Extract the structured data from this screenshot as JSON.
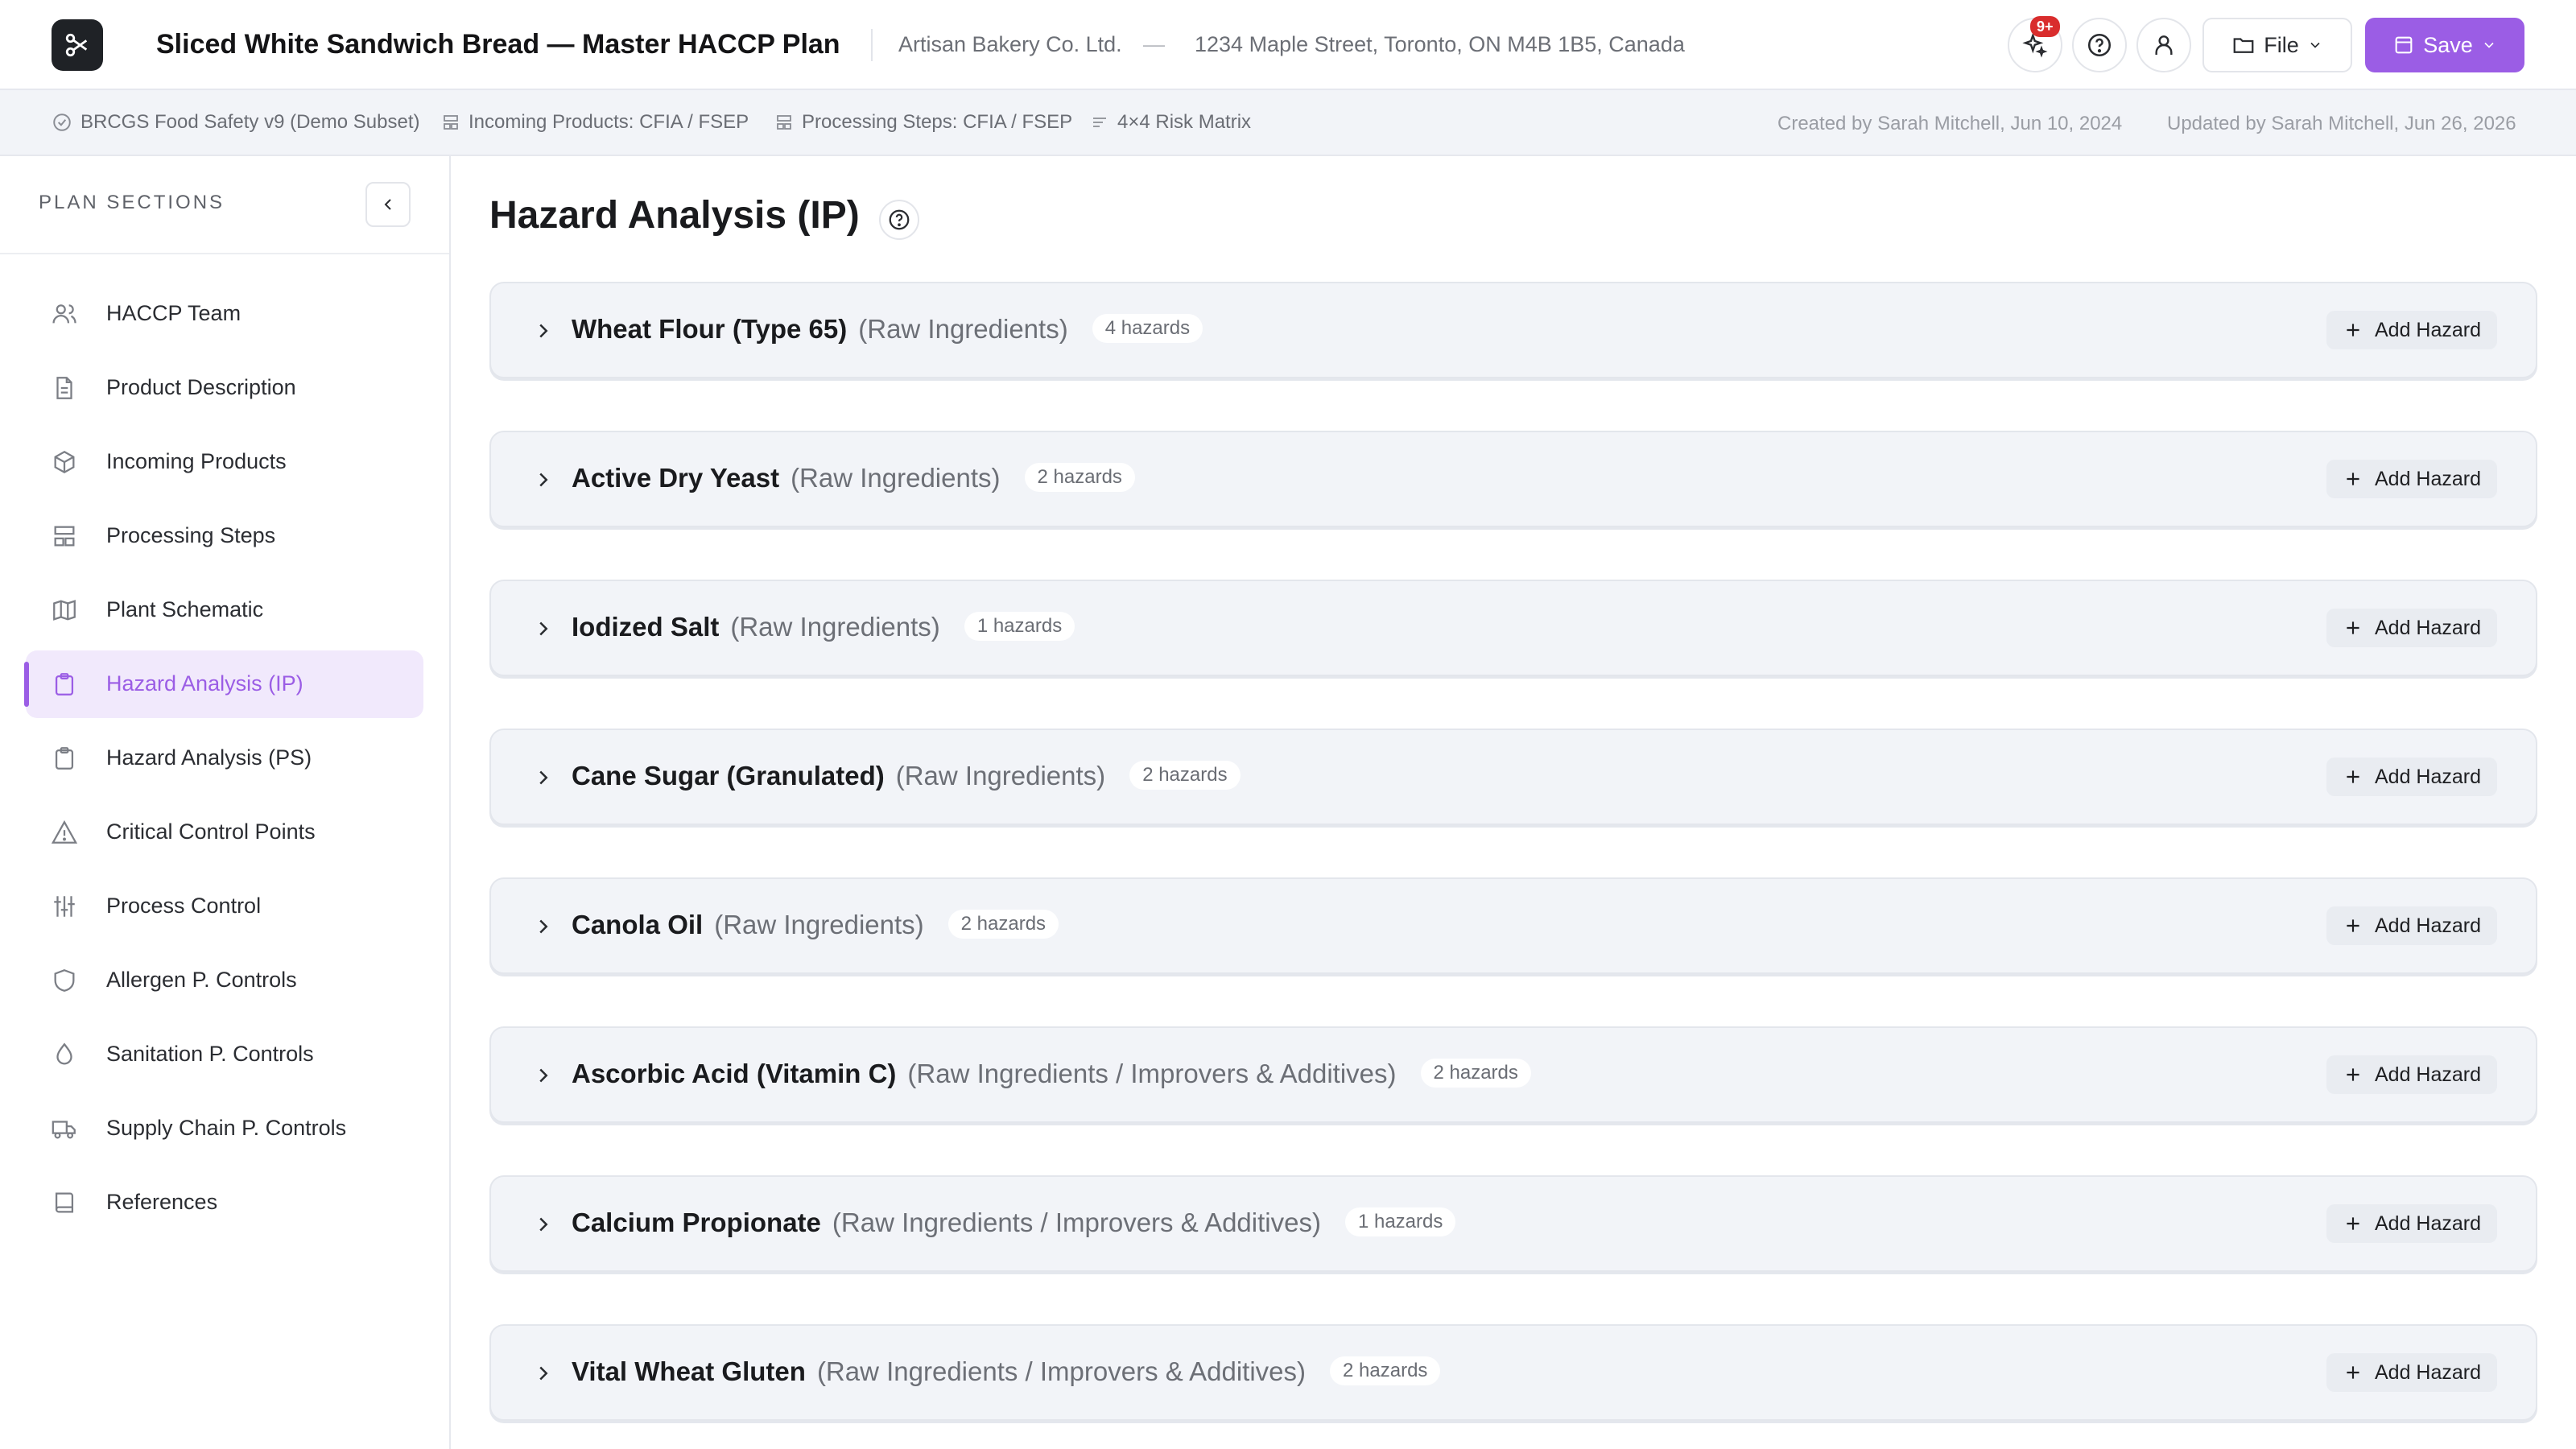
{
  "header": {
    "title": "Sliced White Sandwich Bread — Master HACCP Plan",
    "company": "Artisan Bakery Co. Ltd.",
    "separator": "—",
    "address": "1234 Maple Street, Toronto, ON M4B 1B5, Canada",
    "notification_count": "9+",
    "file_label": "File",
    "save_label": "Save"
  },
  "subbar": {
    "standard": "BRCGS Food Safety v9 (Demo Subset)",
    "incoming": "Incoming Products: CFIA / FSEP",
    "processing": "Processing Steps: CFIA / FSEP",
    "matrix": "4×4 Risk Matrix",
    "created": "Created by Sarah Mitchell, Jun 10, 2024",
    "updated": "Updated by Sarah Mitchell, Jun 26, 2026"
  },
  "sidebar": {
    "heading": "PLAN SECTIONS",
    "items": [
      {
        "label": "HACCP Team",
        "icon": "team-icon"
      },
      {
        "label": "Product Description",
        "icon": "document-icon"
      },
      {
        "label": "Incoming Products",
        "icon": "box-icon"
      },
      {
        "label": "Processing Steps",
        "icon": "layout-icon"
      },
      {
        "label": "Plant Schematic",
        "icon": "map-icon"
      },
      {
        "label": "Hazard Analysis (IP)",
        "icon": "clipboard-icon",
        "active": true
      },
      {
        "label": "Hazard Analysis (PS)",
        "icon": "clipboard-icon"
      },
      {
        "label": "Critical Control Points",
        "icon": "warning-icon"
      },
      {
        "label": "Process Control",
        "icon": "sliders-icon"
      },
      {
        "label": "Allergen P. Controls",
        "icon": "shield-icon"
      },
      {
        "label": "Sanitation P. Controls",
        "icon": "droplet-icon"
      },
      {
        "label": "Supply Chain P. Controls",
        "icon": "truck-icon"
      },
      {
        "label": "References",
        "icon": "book-icon"
      }
    ]
  },
  "main": {
    "title": "Hazard Analysis (IP)",
    "add_label": "Add Hazard",
    "products": [
      {
        "name": "Wheat Flour (Type 65)",
        "category": "(Raw Ingredients)",
        "count": "4 hazards"
      },
      {
        "name": "Active Dry Yeast",
        "category": "(Raw Ingredients)",
        "count": "2 hazards"
      },
      {
        "name": "Iodized Salt",
        "category": "(Raw Ingredients)",
        "count": "1 hazards"
      },
      {
        "name": "Cane Sugar (Granulated)",
        "category": "(Raw Ingredients)",
        "count": "2 hazards"
      },
      {
        "name": "Canola Oil",
        "category": "(Raw Ingredients)",
        "count": "2 hazards"
      },
      {
        "name": "Ascorbic Acid (Vitamin C)",
        "category": "(Raw Ingredients / Improvers & Additives)",
        "count": "2 hazards"
      },
      {
        "name": "Calcium Propionate",
        "category": "(Raw Ingredients / Improvers & Additives)",
        "count": "1 hazards"
      },
      {
        "name": "Vital Wheat Gluten",
        "category": "(Raw Ingredients / Improvers & Additives)",
        "count": "2 hazards"
      }
    ]
  },
  "colors": {
    "accent": "#9b5de5",
    "badge_red": "#d92d2d",
    "card_bg": "#f2f4f8"
  }
}
